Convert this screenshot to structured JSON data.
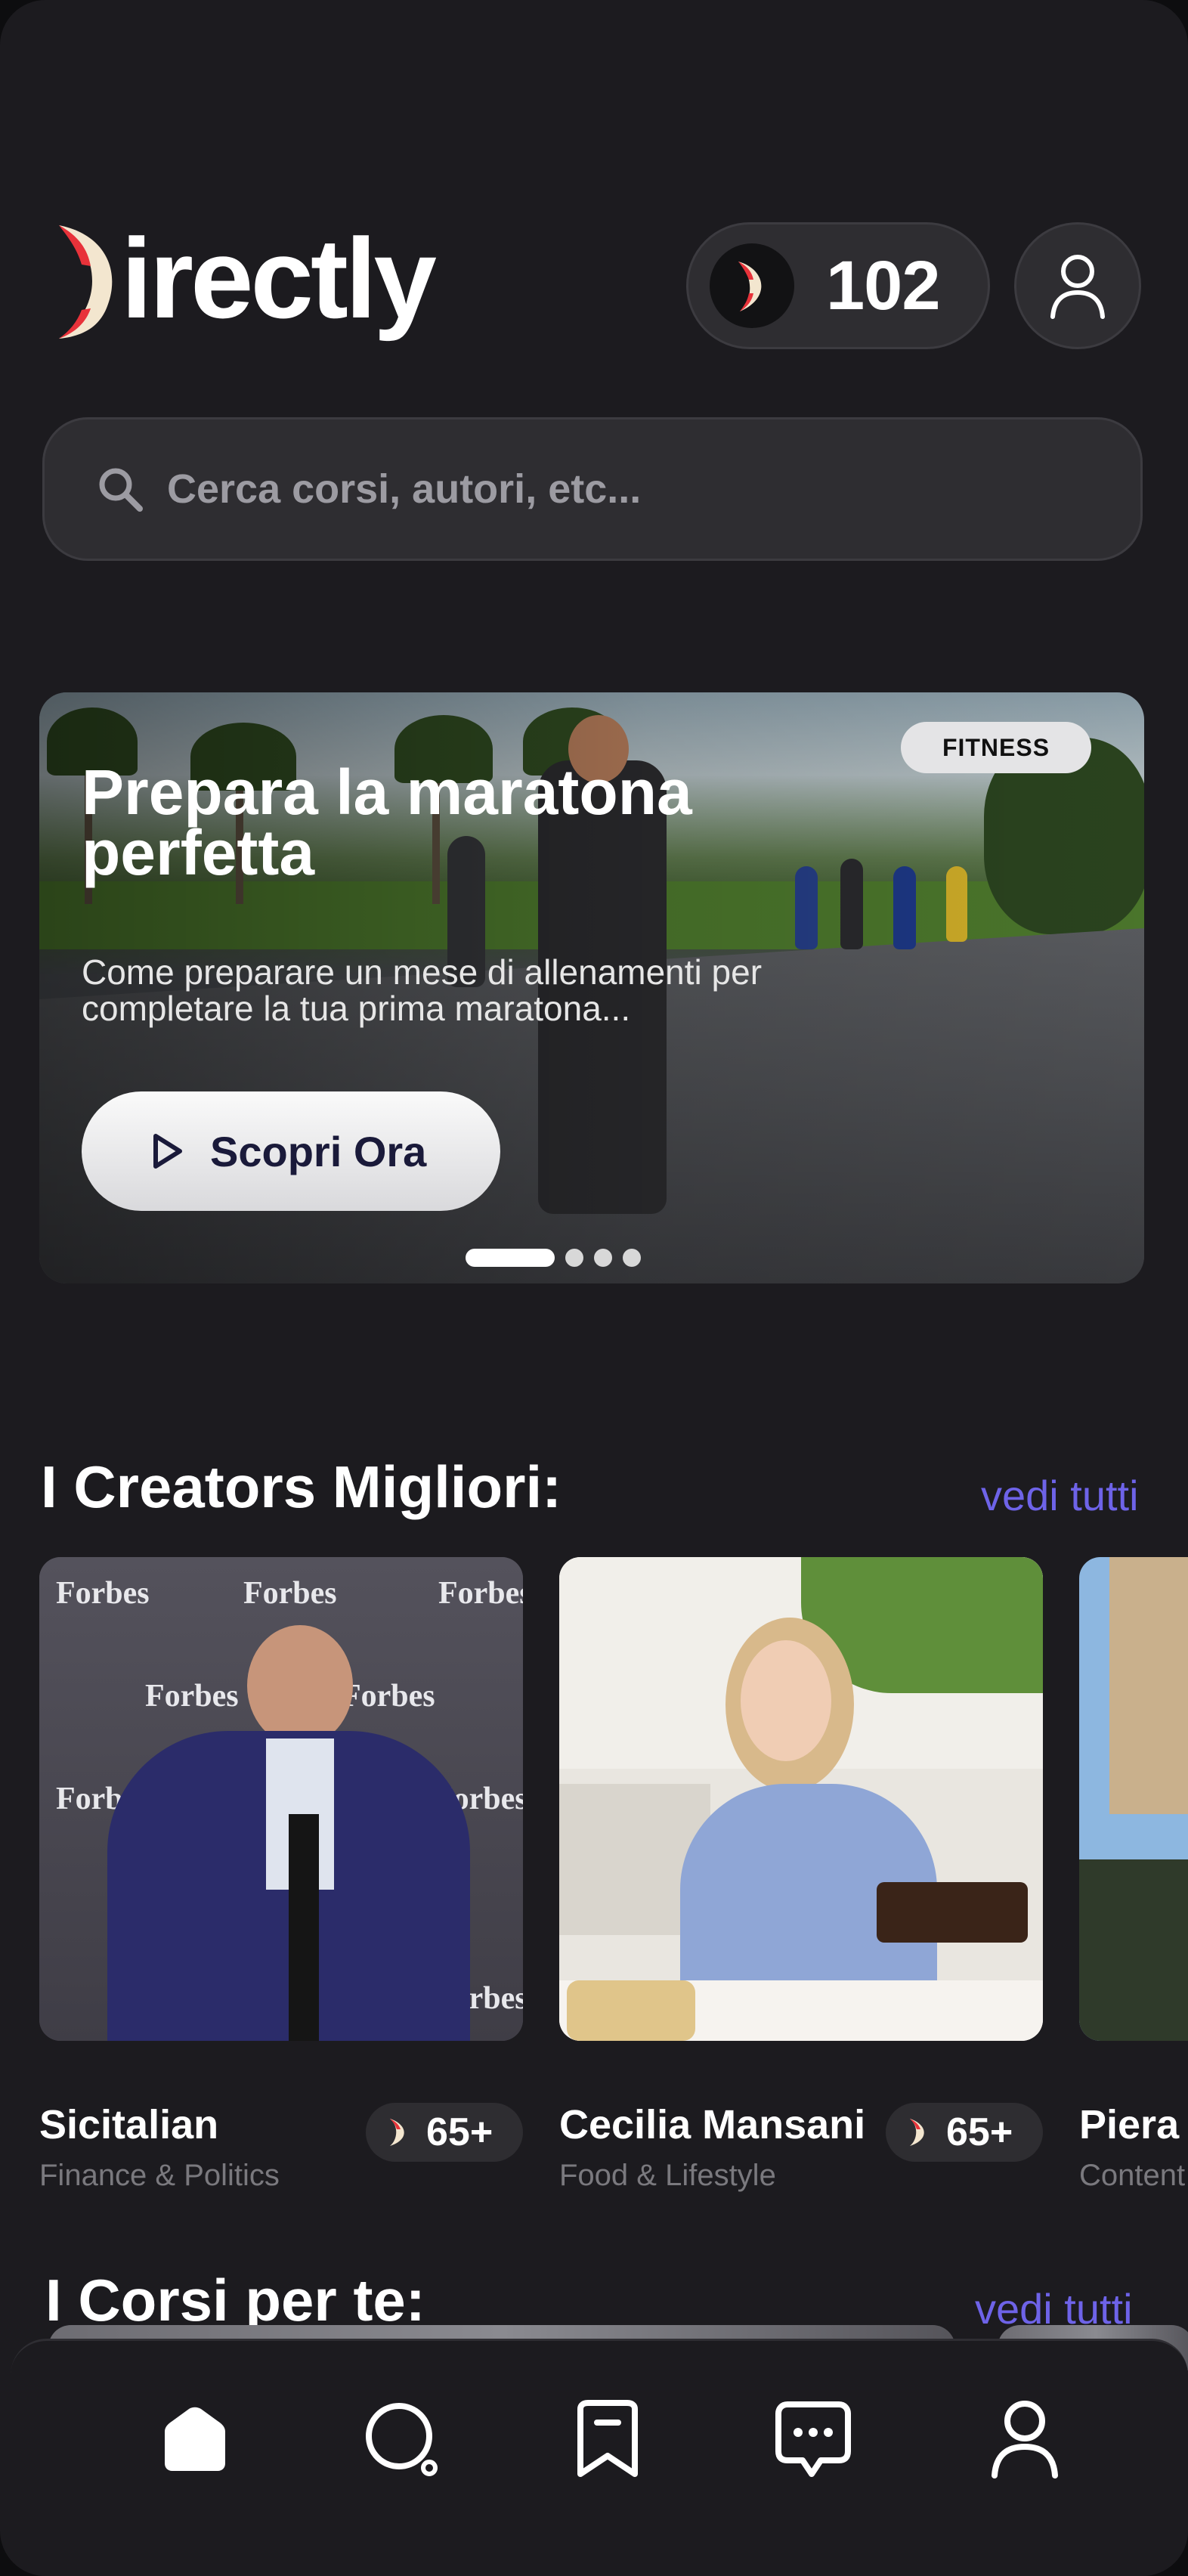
{
  "header": {
    "app_name": "irectly",
    "coins": "102"
  },
  "search": {
    "placeholder": "Cerca corsi, autori, etc..."
  },
  "hero": {
    "badge": "FITNESS",
    "title": "Prepara la maratona perfetta",
    "subtitle": "Come preparare un mese di allenamenti per completare la tua prima maratona...",
    "cta_label": "Scopri Ora",
    "slides_total": 4,
    "active_slide": 1
  },
  "creators": {
    "title": "I Creators Migliori:",
    "see_all": "vedi tutti",
    "items": [
      {
        "name": "Sicitalian",
        "category": "Finance & Politics",
        "price": "65+"
      },
      {
        "name": "Cecilia Mansani",
        "category": "Food & Lifestyle",
        "price": "65+"
      },
      {
        "name": "Piera",
        "category": "Content"
      }
    ],
    "forbes_text": "Forbes"
  },
  "courses": {
    "title": "I Corsi per te:",
    "see_all": "vedi tutti"
  },
  "nav": {
    "items": [
      "home-icon",
      "search-icon",
      "bookmark-icon",
      "chat-icon",
      "profile-icon"
    ]
  },
  "colors": {
    "accent": "#6e63e8",
    "brand_red": "#e8323a",
    "brand_cream": "#f3e6cf",
    "background": "#1c1b1f"
  }
}
